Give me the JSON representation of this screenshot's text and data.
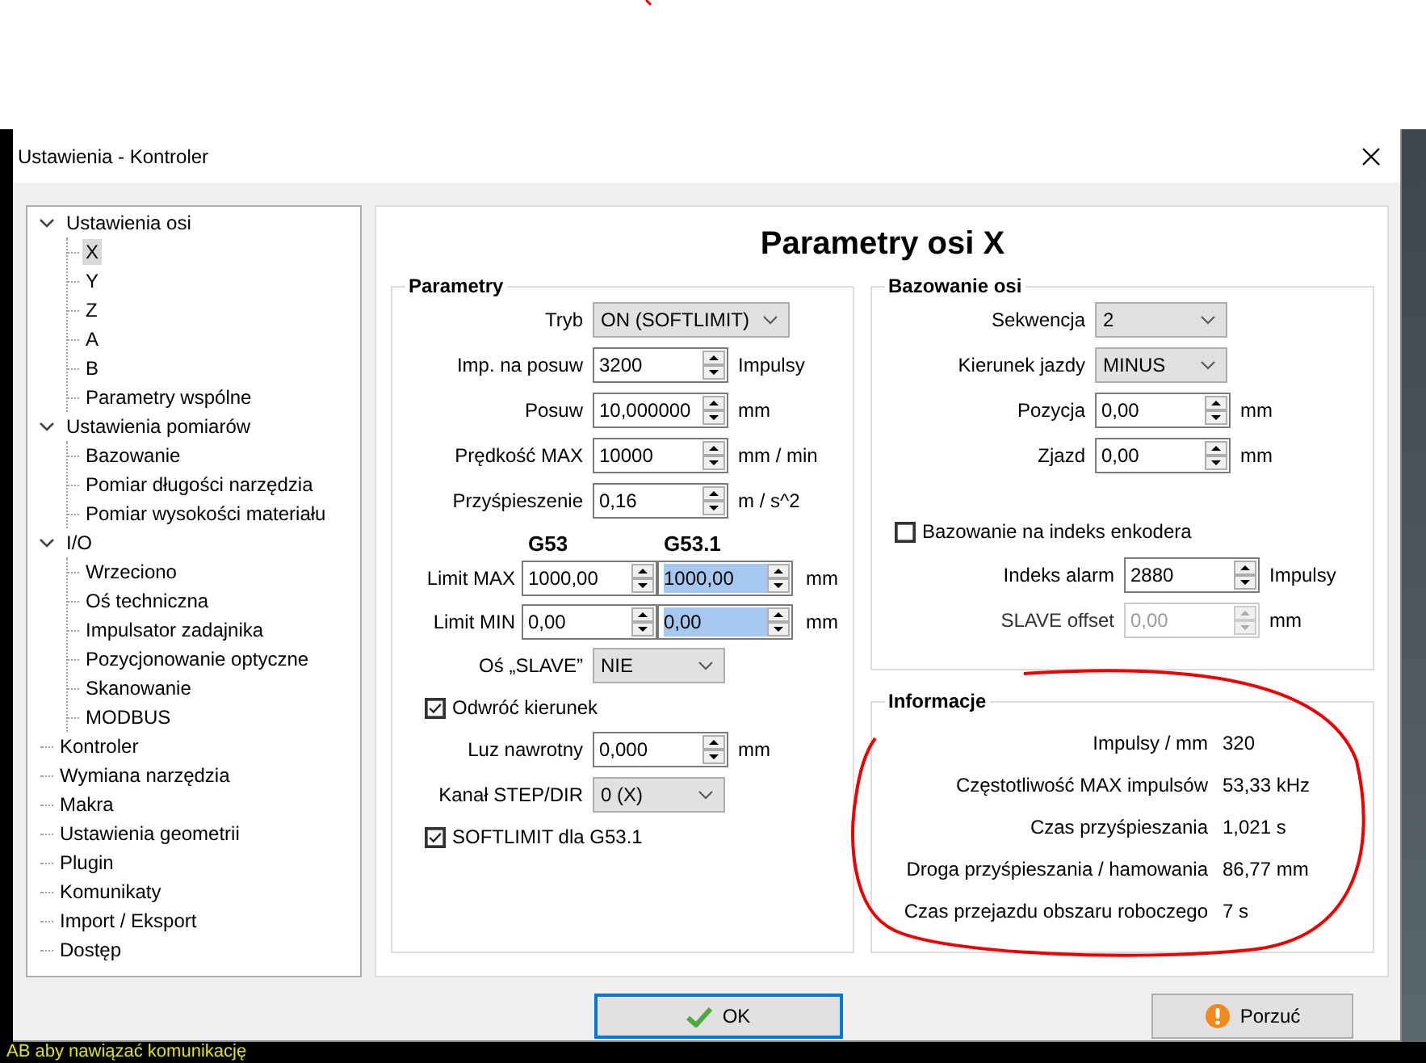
{
  "window": {
    "title": "Ustawienia - Kontroler"
  },
  "tree": [
    {
      "label": "Ustawienia osi",
      "selected": false,
      "expanded": true,
      "children": [
        {
          "label": "X",
          "selected": true
        },
        {
          "label": "Y",
          "selected": false
        },
        {
          "label": "Z",
          "selected": false
        },
        {
          "label": "A",
          "selected": false
        },
        {
          "label": "B",
          "selected": false
        },
        {
          "label": "Parametry wspólne",
          "selected": false
        }
      ]
    },
    {
      "label": "Ustawienia pomiarów",
      "selected": false,
      "expanded": true,
      "children": [
        {
          "label": "Bazowanie",
          "selected": false
        },
        {
          "label": "Pomiar długości narzędzia",
          "selected": false
        },
        {
          "label": "Pomiar wysokości materiału",
          "selected": false
        }
      ]
    },
    {
      "label": "I/O",
      "selected": false,
      "expanded": true,
      "children": [
        {
          "label": "Wrzeciono",
          "selected": false
        },
        {
          "label": "Oś techniczna",
          "selected": false
        },
        {
          "label": "Impulsator zadajnika",
          "selected": false
        },
        {
          "label": "Pozycjonowanie optyczne",
          "selected": false
        },
        {
          "label": "Skanowanie",
          "selected": false
        },
        {
          "label": "MODBUS",
          "selected": false
        }
      ]
    },
    {
      "label": "Kontroler",
      "selected": false
    },
    {
      "label": "Wymiana narzędzia",
      "selected": false
    },
    {
      "label": "Makra",
      "selected": false
    },
    {
      "label": "Ustawienia geometrii",
      "selected": false
    },
    {
      "label": "Plugin",
      "selected": false
    },
    {
      "label": "Komunikaty",
      "selected": false
    },
    {
      "label": "Import / Eksport",
      "selected": false
    },
    {
      "label": "Dostęp",
      "selected": false
    }
  ],
  "page_title": "Parametry osi X",
  "parameters": {
    "title": "Parametry",
    "rows": [
      {
        "kind": "combo",
        "label": "Tryb",
        "value": "ON (SOFTLIMIT)"
      },
      {
        "kind": "spin",
        "label": "Imp. na posuw",
        "value": "3200",
        "unit": "Impulsy",
        "disabled": false
      },
      {
        "kind": "spin",
        "label": "Posuw",
        "value": "10,000000",
        "unit": "mm",
        "disabled": false
      },
      {
        "kind": "spin",
        "label": "Prędkość MAX",
        "value": "10000",
        "unit": "mm / min",
        "disabled": false
      },
      {
        "kind": "spin",
        "label": "Przyśpieszenie",
        "value": "0,16",
        "unit": "m / s^2",
        "disabled": false
      },
      {
        "kind": "columns",
        "columns": [
          "G53",
          "G53.1"
        ]
      },
      {
        "kind": "pair",
        "label": "Limit MAX",
        "unit": "mm",
        "values": [
          {
            "value": "1000,00",
            "highlighted": false
          },
          {
            "value": "1000,00",
            "highlighted": true
          }
        ]
      },
      {
        "kind": "pair",
        "label": "Limit MIN",
        "unit": "mm",
        "values": [
          {
            "value": "0,00",
            "highlighted": false
          },
          {
            "value": "0,00",
            "highlighted": true
          }
        ]
      },
      {
        "kind": "combo",
        "label": "Oś „SLAVE”",
        "value": "NIE"
      },
      {
        "kind": "checkbox",
        "label": "Odwróć kierunek",
        "checked": true
      },
      {
        "kind": "spin",
        "label": "Luz nawrotny",
        "value": "0,000",
        "unit": "mm",
        "disabled": false
      },
      {
        "kind": "combo",
        "label": "Kanał STEP/DIR",
        "value": "0 (X)"
      },
      {
        "kind": "checkbox",
        "label": "SOFTLIMIT dla G53.1",
        "checked": true
      }
    ]
  },
  "homing": {
    "title": "Bazowanie osi",
    "rows": [
      {
        "kind": "combo",
        "label": "Sekwencja",
        "value": "2"
      },
      {
        "kind": "combo",
        "label": "Kierunek jazdy",
        "value": "MINUS"
      },
      {
        "kind": "spin",
        "label": "Pozycja",
        "value": "0,00",
        "unit": "mm",
        "disabled": false
      },
      {
        "kind": "spin",
        "label": "Zjazd",
        "value": "0,00",
        "unit": "mm",
        "disabled": false
      },
      {
        "kind": "checkbox",
        "label": "Bazowanie na indeks enkodera",
        "checked": false
      },
      {
        "kind": "spin",
        "label": "Indeks alarm",
        "value": "2880",
        "unit": "Impulsy",
        "disabled": false
      },
      {
        "kind": "spin",
        "label": "SLAVE offset",
        "value": "0,00",
        "unit": "mm",
        "disabled": true
      }
    ]
  },
  "info": {
    "title": "Informacje",
    "rows": [
      {
        "label": "Impulsy / mm",
        "value": "320"
      },
      {
        "label": "Częstotliwość MAX impulsów",
        "value": "53,33 kHz"
      },
      {
        "label": "Czas przyśpieszania",
        "value": "1,021 s"
      },
      {
        "label": "Droga przyśpieszania / hamowania",
        "value": "86,77 mm"
      },
      {
        "label": "Czas przejazdu obszaru roboczego",
        "value": "7 s"
      }
    ]
  },
  "buttons": [
    {
      "kind": "ok",
      "label": "OK",
      "focused": true
    },
    {
      "kind": "cancel",
      "label": "Porzuć",
      "focused": false
    }
  ],
  "background_text": "AB aby nawiązać komunikację"
}
